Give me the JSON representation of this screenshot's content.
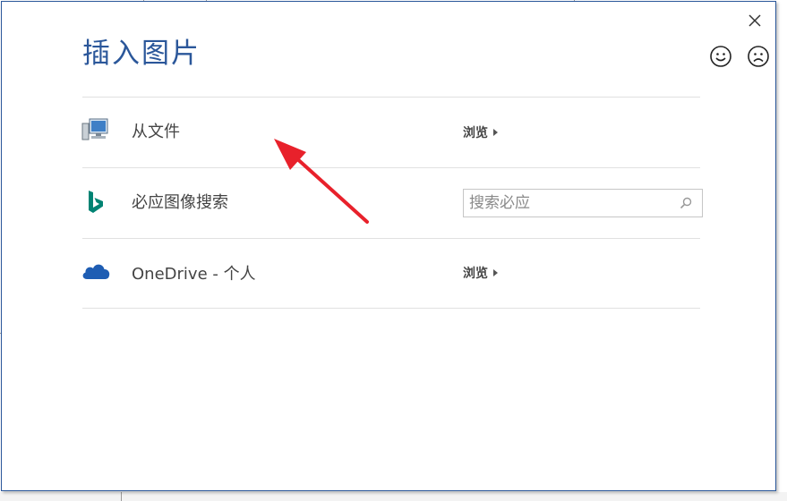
{
  "dialog": {
    "title": "插入图片",
    "close_icon": "close-icon",
    "feedback": {
      "smile_icon": "smile-icon",
      "frown_icon": "frown-icon"
    }
  },
  "rows": [
    {
      "label": "从文件",
      "icon": "computer-icon",
      "action": "浏览"
    },
    {
      "label": "必应图像搜索",
      "icon": "bing-icon",
      "search_placeholder": "搜索必应"
    },
    {
      "label": "OneDrive - 个人",
      "icon": "onedrive-cloud-icon",
      "action": "浏览"
    }
  ],
  "annotation": {
    "arrow_color": "#e8212b"
  },
  "colors": {
    "accent": "#2b579a",
    "bing": "#008373",
    "onedrive": "#1e5db3"
  }
}
